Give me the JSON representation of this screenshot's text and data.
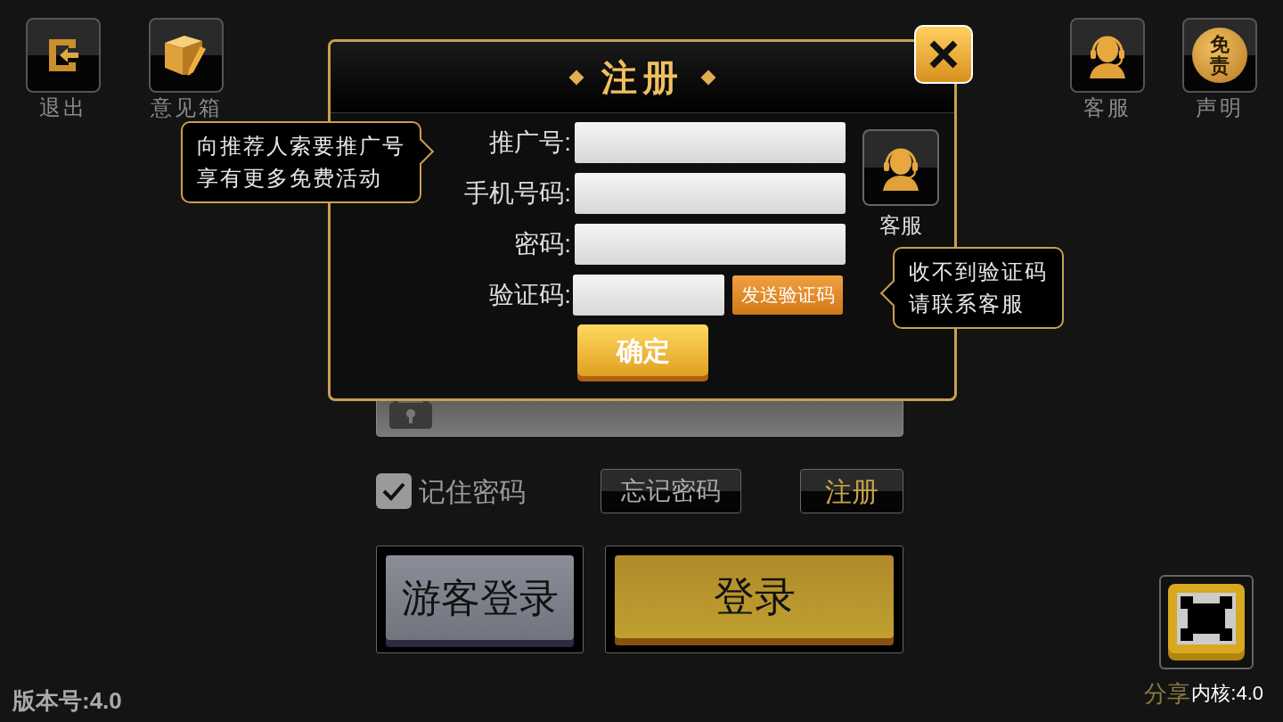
{
  "top_left": [
    {
      "label": "退出",
      "kind": "exit"
    },
    {
      "label": "意见箱",
      "kind": "feedback"
    }
  ],
  "top_right": [
    {
      "label": "客服",
      "kind": "service"
    },
    {
      "label": "声明",
      "kind": "disclaimer",
      "icon_text": "免责"
    }
  ],
  "login": {
    "remember": {
      "label": "记住密码",
      "checked": true
    },
    "forgot": "忘记密码",
    "register": "注册",
    "guest": "游客登录",
    "login": "登录"
  },
  "share": {
    "label": "分享"
  },
  "kernel": "内核:4.0",
  "version": "版本号:4.0",
  "dialog": {
    "title": "注册",
    "fields": [
      {
        "label": "推广号:",
        "kind": "text"
      },
      {
        "label": "手机号码:",
        "kind": "text"
      },
      {
        "label": "密码:",
        "kind": "text"
      },
      {
        "label": "验证码:",
        "kind": "code",
        "button": "发送验证码"
      }
    ],
    "confirm": "确定",
    "service": "客服",
    "tip_left": [
      "向推荐人索要推广号",
      "享有更多免费活动"
    ],
    "tip_right": [
      "收不到验证码",
      "请联系客服"
    ]
  }
}
